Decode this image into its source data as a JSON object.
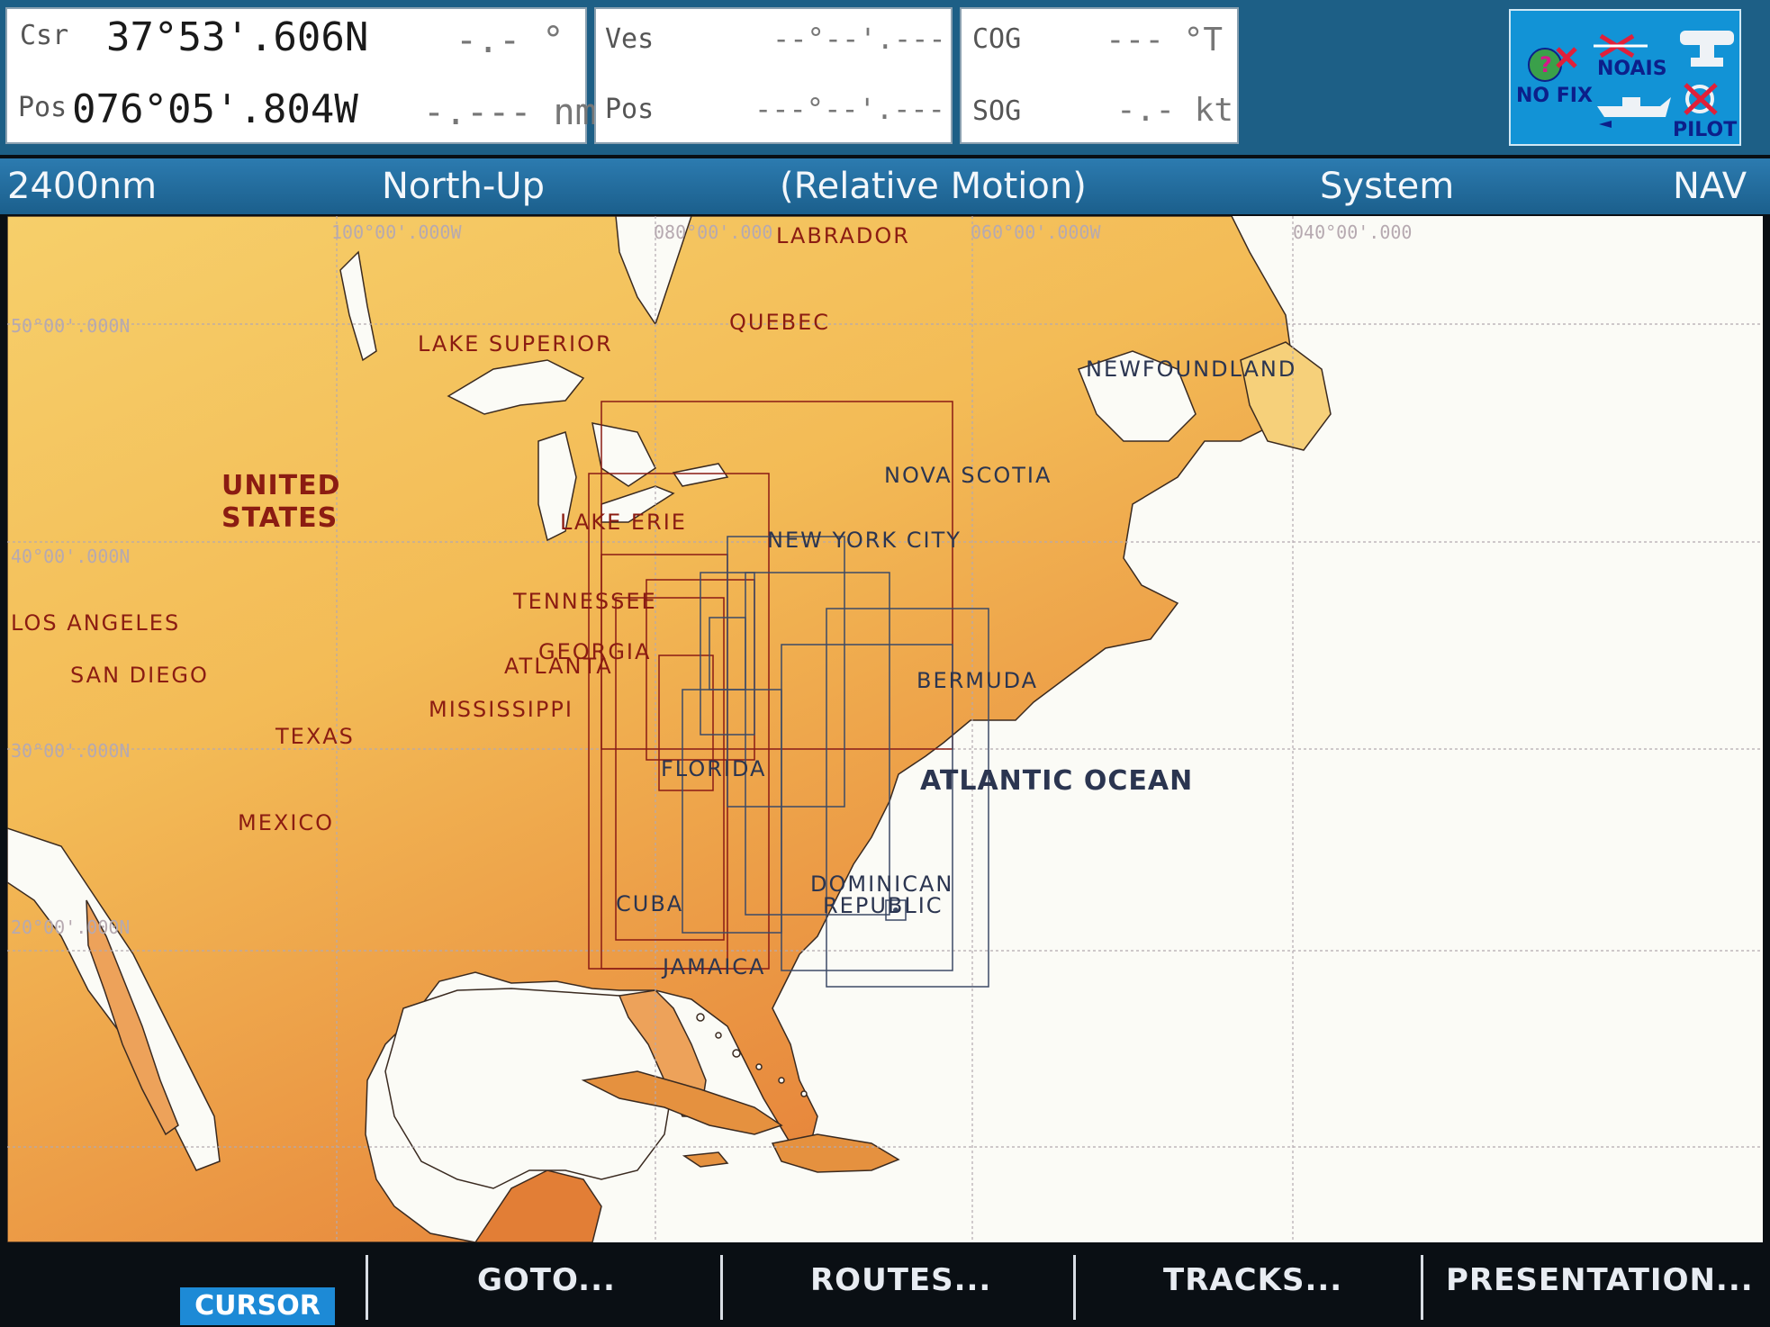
{
  "top": {
    "cursor_label": "Csr",
    "cursor_lat": "37°53'.606N",
    "cursor_brg": "-.- °",
    "pos_label": "Pos",
    "cursor_lon": "076°05'.804W",
    "cursor_rng": "-.--- nm",
    "ves_label": "Ves",
    "ves_lat": "--°--'.---",
    "ves_pos_label": "Pos",
    "ves_lon": "---°--'.---",
    "cog_label": "COG",
    "cog_value": "--- °T",
    "sog_label": "SOG",
    "sog_value": "-.- kt"
  },
  "status": {
    "no_fix": "NO FIX",
    "no_ais": "NOAIS",
    "pilot": "PILOT"
  },
  "header": {
    "range": "2400nm",
    "orientation": "North-Up",
    "motion": "(Relative Motion)",
    "system": "System",
    "mode": "NAV"
  },
  "grid_labels": {
    "lon_100": "100°00'.000W",
    "lon_080": "080°00'.000",
    "lon_060": "060°00'.000W",
    "lon_040": "040°00'.000",
    "lat_50": "50°00'.000N",
    "lat_40": "40°00'.000N",
    "lat_30": "30°00'.000N",
    "lat_20": "20°00'.000N"
  },
  "places": {
    "labrador": "LABRADOR",
    "quebec": "QUEBEC",
    "lake_superior": "LAKE SUPERIOR",
    "newfoundland": "NEWFOUNDLAND",
    "united": "UNITED",
    "states": "STATES",
    "nova_scotia": "NOVA SCOTIA",
    "lake_erie": "LAKE ERIE",
    "new_york_city": "NEW YORK CITY",
    "tennessee": "TENNESSEE",
    "los_angeles": "LOS ANGELES",
    "georgia": "GEORGIA",
    "atlanta": "ATLANTA",
    "san_diego": "SAN DIEGO",
    "bermuda": "BERMUDA",
    "mississippi": "MISSISSIPPI",
    "texas": "TEXAS",
    "florida": "FLORIDA",
    "atlantic_ocean": "ATLANTIC OCEAN",
    "mexico": "MEXICO",
    "dominican": "DOMINICAN",
    "republic": "REPUBLIC",
    "cuba": "CUBA",
    "jamaica": "JAMAICA"
  },
  "softkeys": {
    "cursor": "CURSOR",
    "goto": "GOTO...",
    "routes": "ROUTES...",
    "tracks": "TRACKS...",
    "presentation": "PRESENTATION..."
  }
}
